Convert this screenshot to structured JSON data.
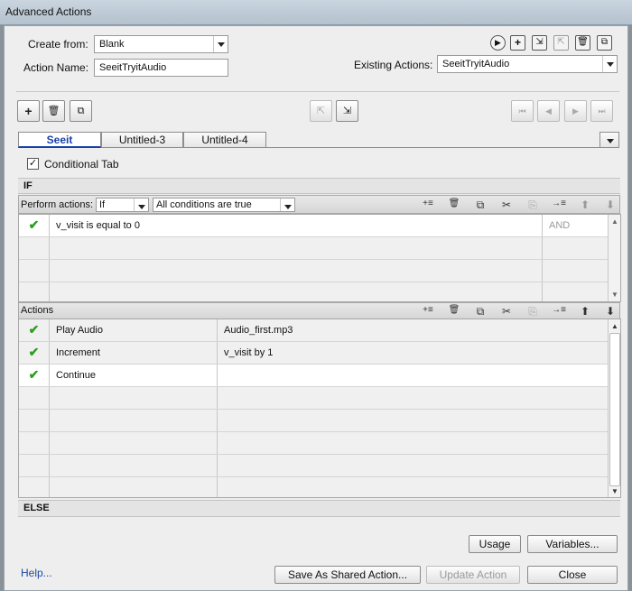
{
  "window": {
    "title": "Advanced Actions"
  },
  "form": {
    "create_from_label": "Create from:",
    "create_from_value": "Blank",
    "action_name_label": "Action Name:",
    "action_name_value": "SeeitTryitAudio",
    "existing_actions_label": "Existing Actions:",
    "existing_actions_value": "SeeitTryitAudio"
  },
  "top_icons": {
    "play": "▶",
    "add": "+",
    "import": "⇲",
    "export": "⇱",
    "delete": "🗑",
    "duplicate": "⧉"
  },
  "toolbar": {
    "add": "+",
    "delete": "🗑",
    "copy": "⧉",
    "mid1": "⇱",
    "mid2": "⇲",
    "first": "⏮",
    "prev": "◀",
    "next": "▶",
    "last": "⏭"
  },
  "tabs": [
    {
      "label": "Seeit"
    },
    {
      "label": "Untitled-3"
    },
    {
      "label": "Untitled-4"
    }
  ],
  "conditional_tab": {
    "checked": true,
    "check_mark": "✓",
    "label": "Conditional Tab"
  },
  "if_header": "IF",
  "perform": {
    "label": "Perform actions:",
    "mode": "If",
    "condition_scope": "All conditions are true"
  },
  "grid_tools": {
    "insert": "+≡",
    "delete": "🗑",
    "copy": "⧉",
    "cut": "✂",
    "paste": "⎘",
    "indent": "→≡",
    "up": "⬆",
    "down": "⬇"
  },
  "conditions": [
    {
      "check": "✔",
      "text": "v_visit   is equal to   0",
      "op": "AND"
    }
  ],
  "actions_label": "Actions",
  "actions": [
    {
      "check": "✔",
      "action": "Play Audio",
      "target": "Audio_first.mp3"
    },
    {
      "check": "✔",
      "action": "Increment",
      "target": "v_visit   by   1"
    },
    {
      "check": "✔",
      "action": "Continue",
      "target": ""
    }
  ],
  "else_header": "ELSE",
  "buttons": {
    "usage": "Usage",
    "variables": "Variables...",
    "help": "Help...",
    "save_shared": "Save As Shared Action...",
    "update": "Update Action",
    "close": "Close"
  }
}
